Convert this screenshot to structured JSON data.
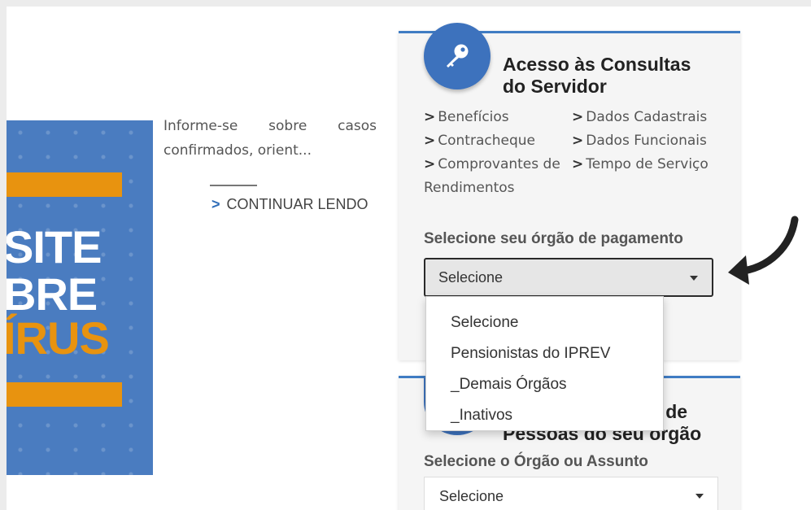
{
  "banner": {
    "word1": "SITE",
    "word2": "BRE",
    "word3": "ÍRUS"
  },
  "article": {
    "excerpt_line1": "Informe-se sobre casos",
    "excerpt_line2": "confirmados, orient...",
    "continue_label": "CONTINUAR LENDO"
  },
  "card": {
    "title_line1": "Acesso às Consultas",
    "title_line2": "do Servidor",
    "links_left": [
      "Benefícios",
      "Contracheque",
      "Comprovantes de Rendimentos"
    ],
    "links_right": [
      "Dados Cadastrais",
      "Dados Funcionais",
      "Tempo de Serviço"
    ],
    "field_label": "Selecione seu órgão de pagamento",
    "select_value": "Selecione"
  },
  "dropdown": {
    "options": [
      "Selecione",
      "Pensionistas do IPREV",
      "_Demais Órgãos",
      "_Inativos"
    ]
  },
  "card2": {
    "title_line1": "ão de",
    "title_line2": "Pessoas do seu órgão",
    "field_label": "Selecione o Órgão ou Assunto",
    "select_value": "Selecione"
  },
  "colors": {
    "accent_blue": "#3d72bd",
    "banner_orange": "#e8930f",
    "banner_blue": "#4a7cc0"
  }
}
